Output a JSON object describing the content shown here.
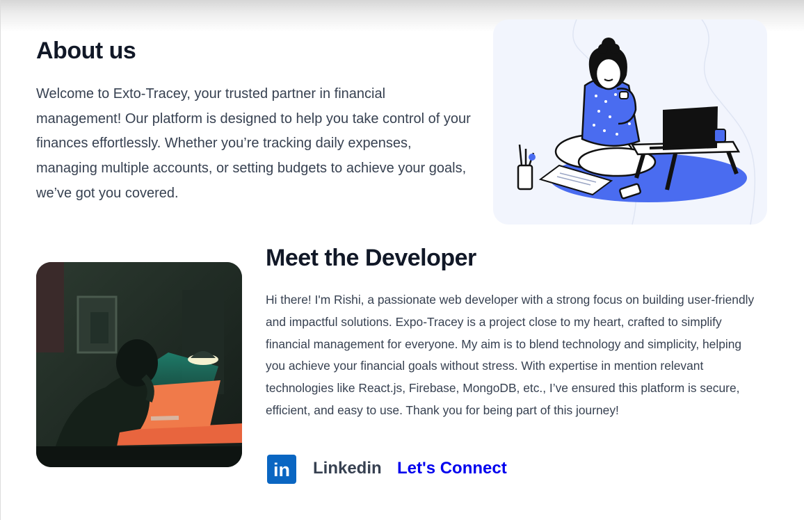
{
  "about": {
    "title": "About us",
    "text": "Welcome to Exto-Tracey, your trusted partner in financial management! Our platform is designed to help you take control of your finances effortlessly. Whether you’re tracking daily expenses, managing multiple accounts, or setting budgets to achieve your goals, we’ve got you covered."
  },
  "developer": {
    "title": "Meet the Developer",
    "bio": "Hi there! I'm Rishi, a passionate web developer with a strong focus on building user-friendly and impactful solutions. Expo-Tracey is a project close to my heart, crafted to simplify financial management for everyone. My aim is to blend technology and simplicity, helping you achieve your financial goals without stress. With expertise in mention relevant technologies like React.js, Firebase, MongoDB, etc., I’ve ensured this platform is secure, efficient, and easy to use. Thank you for being part of this journey!"
  },
  "social": {
    "icon_text": "in",
    "label": "Linkedin",
    "connect_text": "Let's Connect"
  },
  "colors": {
    "heading": "#111827",
    "body_text": "#374151",
    "link": "#0000ee",
    "linkedin_brand": "#0a66c2",
    "illustration_accent": "#4a6cf0"
  },
  "icons": [
    "linkedin-icon",
    "working-woman-illustration",
    "developer-photo"
  ]
}
